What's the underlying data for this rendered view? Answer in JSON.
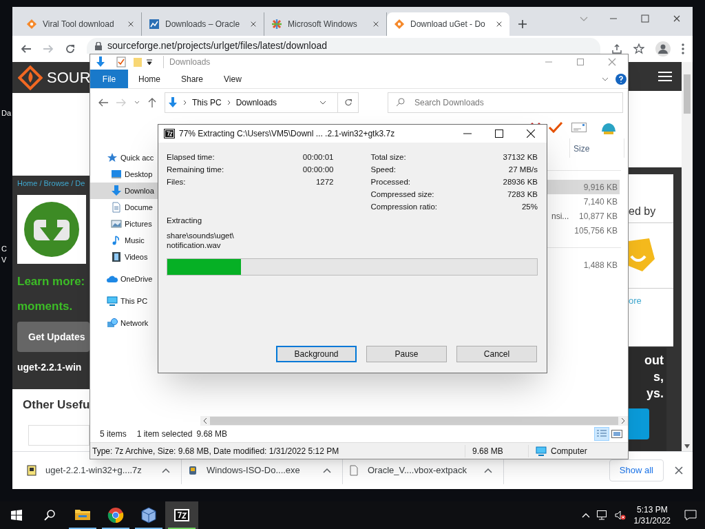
{
  "desktop": {
    "icon_labels": [
      "Da",
      "C",
      "V"
    ]
  },
  "browser": {
    "tabs": [
      {
        "title": "Viral Tool download",
        "kind": "diamond",
        "selected": false
      },
      {
        "title": "Downloads – Oracle",
        "kind": "chart",
        "selected": false
      },
      {
        "title": "Microsoft Windows",
        "kind": "knot",
        "selected": false
      },
      {
        "title": "Download uGet - Do",
        "kind": "diamond",
        "selected": true
      }
    ],
    "address": "sourceforge.net/projects/urlget/files/latest/download",
    "page": {
      "logo_text": "SOUR",
      "breadcrumb": "Home / Browse / De",
      "promo_lines": [
        "Learn more:",
        "moments."
      ],
      "button": "Get Updates",
      "file_name": "uget-2.2.1-win",
      "section_title": "Other Usefu",
      "side_caption": "ed by",
      "side_link": "ore",
      "side_heading_lines": [
        "out",
        "s,",
        "ys."
      ]
    },
    "downloads": [
      {
        "name": "uget-2.2.1-win32+g....7z",
        "kind": "archive"
      },
      {
        "name": "Windows-ISO-Do....exe",
        "kind": "installer"
      },
      {
        "name": "Oracle_V....vbox-extpack",
        "kind": "file"
      }
    ],
    "show_all": "Show all"
  },
  "explorer": {
    "title": "Downloads",
    "ribbon_tabs": [
      {
        "label": "File",
        "selected": true
      },
      {
        "label": "Home",
        "selected": false
      },
      {
        "label": "Share",
        "selected": false
      },
      {
        "label": "View",
        "selected": false
      }
    ],
    "breadcrumb": [
      "This PC",
      "Downloads"
    ],
    "search": {
      "placeholder": "Search Downloads"
    },
    "nav": [
      {
        "label": "Quick acc",
        "kind": "quick",
        "selected": false
      },
      {
        "label": "Desktop",
        "kind": "desktop",
        "selected": false
      },
      {
        "label": "Downloa",
        "kind": "downloads",
        "selected": true
      },
      {
        "label": "Docume",
        "kind": "documents",
        "selected": false
      },
      {
        "label": "Pictures",
        "kind": "pictures",
        "selected": false
      },
      {
        "label": "Music",
        "kind": "music",
        "selected": false
      },
      {
        "label": "Videos",
        "kind": "videos",
        "selected": false
      },
      {
        "label": "OneDrive",
        "kind": "onedrive",
        "selected": false
      },
      {
        "label": "This PC",
        "kind": "thispc",
        "selected": false
      },
      {
        "label": "Network",
        "kind": "network",
        "selected": false
      }
    ],
    "column": "Size",
    "row_groups": [
      [
        {
          "size": "9,916 KB",
          "selected": true
        },
        {
          "size": "7,140 KB",
          "selected": false
        },
        {
          "name": "nsi...",
          "size": "10,877 KB",
          "selected": false
        },
        {
          "size": "105,756 KB",
          "selected": false
        }
      ],
      [
        {
          "size": "1,488 KB",
          "selected": false
        }
      ]
    ],
    "status": {
      "items": "5 items",
      "selection": "1 item selected",
      "selection_size": "9.68 MB"
    },
    "details": {
      "text": "Type: 7z Archive, Size: 9.68 MB, Date modified: 1/31/2022 5:12 PM",
      "size": "9.68 MB",
      "location": "Computer"
    }
  },
  "dialog": {
    "title": "77% Extracting C:\\Users\\VM5\\Downl ... .2.1-win32+gtk3.7z",
    "stats_left": [
      {
        "label": "Elapsed time:",
        "value": "00:00:01"
      },
      {
        "label": "Remaining time:",
        "value": "00:00:00"
      },
      {
        "label": "Files:",
        "value": "1272"
      }
    ],
    "stats_right": [
      {
        "label": "Total size:",
        "value": "37132 KB"
      },
      {
        "label": "Speed:",
        "value": "27 MB/s"
      },
      {
        "label": "Processed:",
        "value": "28936 KB"
      },
      {
        "label": "Compressed size:",
        "value": "7283 KB"
      },
      {
        "label": "Compression ratio:",
        "value": "25%"
      }
    ],
    "status": "Extracting",
    "file_lines": [
      "share\\sounds\\uget\\",
      "notification.wav"
    ],
    "progress": {
      "level": 0.2
    },
    "buttons": [
      {
        "label": "Background",
        "focused": true
      },
      {
        "label": "Pause",
        "focused": false
      },
      {
        "label": "Cancel",
        "focused": false
      }
    ]
  },
  "taskbar": {
    "apps": [
      {
        "kind": "explorer",
        "running": true,
        "active": false
      },
      {
        "kind": "chrome",
        "running": true,
        "active": false
      },
      {
        "kind": "virtualbox",
        "running": true,
        "active": false
      },
      {
        "kind": "sevenzip",
        "running": true,
        "active": true
      }
    ],
    "time": "5:13 PM",
    "date": "1/31/2022"
  }
}
